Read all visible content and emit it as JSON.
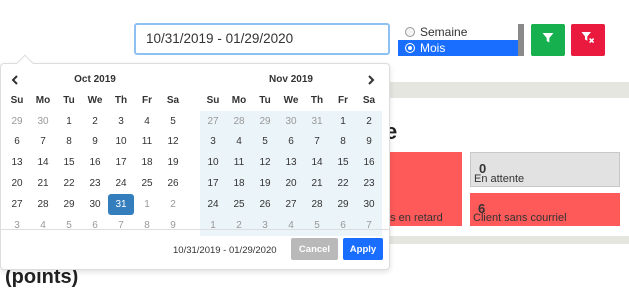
{
  "toolbar": {
    "date_range_value": "10/31/2019 - 01/29/2020",
    "period_options": [
      {
        "label": "Semaine",
        "selected": false
      },
      {
        "label": "Mois",
        "selected": true
      }
    ],
    "filter_icon": "filter-icon",
    "clear_filter_icon": "filter-clear-icon",
    "colors": {
      "filter": "#16b04e",
      "clear": "#ea1a3f",
      "selected": "#1a6eff"
    }
  },
  "background": {
    "heading_fragment": "e",
    "cards": [
      {
        "count": "",
        "label": ""
      },
      {
        "count": "0",
        "label": "En attente"
      },
      {
        "count": "",
        "label": "es en retard"
      },
      {
        "count": "6",
        "label": "Client sans courriel"
      }
    ],
    "bottom_heading": "(points)"
  },
  "datepicker": {
    "weekdays": [
      "Su",
      "Mo",
      "Tu",
      "We",
      "Th",
      "Fr",
      "Sa"
    ],
    "calendars": [
      {
        "title": "Oct 2019",
        "weeks": [
          [
            "29",
            "30",
            "1",
            "2",
            "3",
            "4",
            "5"
          ],
          [
            "6",
            "7",
            "8",
            "9",
            "10",
            "11",
            "12"
          ],
          [
            "13",
            "14",
            "15",
            "16",
            "17",
            "18",
            "19"
          ],
          [
            "20",
            "21",
            "22",
            "23",
            "24",
            "25",
            "26"
          ],
          [
            "27",
            "28",
            "29",
            "30",
            "31",
            "1",
            "2"
          ],
          [
            "3",
            "4",
            "5",
            "6",
            "7",
            "8",
            "9"
          ]
        ]
      },
      {
        "title": "Nov 2019",
        "weeks": [
          [
            "27",
            "28",
            "29",
            "30",
            "31",
            "1",
            "2"
          ],
          [
            "3",
            "4",
            "5",
            "6",
            "7",
            "8",
            "9"
          ],
          [
            "10",
            "11",
            "12",
            "13",
            "14",
            "15",
            "16"
          ],
          [
            "17",
            "18",
            "19",
            "20",
            "21",
            "22",
            "23"
          ],
          [
            "24",
            "25",
            "26",
            "27",
            "28",
            "29",
            "30"
          ],
          [
            "1",
            "2",
            "3",
            "4",
            "5",
            "6",
            "7"
          ]
        ]
      }
    ],
    "selected_start": "Oct 31",
    "footer_range": "10/31/2019 - 01/29/2020",
    "cancel_label": "Cancel",
    "apply_label": "Apply"
  }
}
